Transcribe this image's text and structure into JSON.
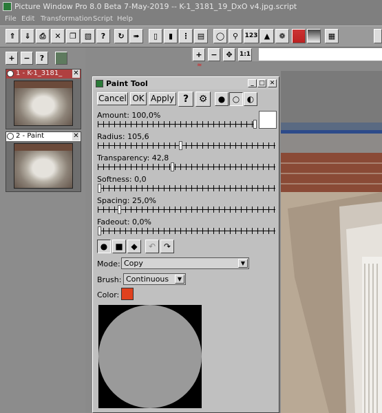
{
  "window": {
    "title": "Picture Window Pro 8.0 Beta 7-May-2019  --  K-1_3181_19_DxO v4.jpg.script"
  },
  "menu": [
    "File",
    "Edit",
    "Transformation",
    "Script",
    "Help"
  ],
  "toolbar": {
    "icons": [
      "open-icon",
      "save-icon",
      "print-icon",
      "close-icon",
      "copy-icon",
      "paste-icon",
      "help-icon",
      "refresh-icon",
      "run-icon",
      "single-view-icon",
      "split-view-icon",
      "multi-view-icon",
      "film-icon",
      "mouse-icon",
      "zoom-icon",
      "number-icon",
      "histogram-icon",
      "palette-icon",
      "gradient-icon",
      "gray-icon",
      "grid-icon"
    ],
    "number_label": "123"
  },
  "left_panel": {
    "thumbnails": [
      {
        "label": "1 - K-1_3181_",
        "selected": false
      },
      {
        "label": "2 - Paint",
        "selected": true
      }
    ]
  },
  "canvas_toolbar": {
    "one_to_one_label": "1:1"
  },
  "paint_tool": {
    "title": "Paint Tool",
    "buttons": {
      "cancel": "Cancel",
      "ok": "OK",
      "apply": "Apply",
      "help": "?"
    },
    "sliders": [
      {
        "label": "Amount: 100,0%",
        "value": 100.0
      },
      {
        "label": "Radius: 105,6",
        "value": 105.6
      },
      {
        "label": "Transparency: 42,8",
        "value": 42.8
      },
      {
        "label": "Softness: 0,0",
        "value": 0.0
      },
      {
        "label": "Spacing: 25,0%",
        "value": 25.0
      },
      {
        "label": "Fadeout: 0,0%",
        "value": 0.0
      }
    ],
    "mode": {
      "label": "Mode:",
      "value": "Copy"
    },
    "brush": {
      "label": "Brush:",
      "value": "Continuous"
    },
    "color": {
      "label": "Color:",
      "value": "#e0411e"
    }
  },
  "colors": {
    "accent_red": "#e0411e",
    "swatch_white": "#ffffff"
  }
}
